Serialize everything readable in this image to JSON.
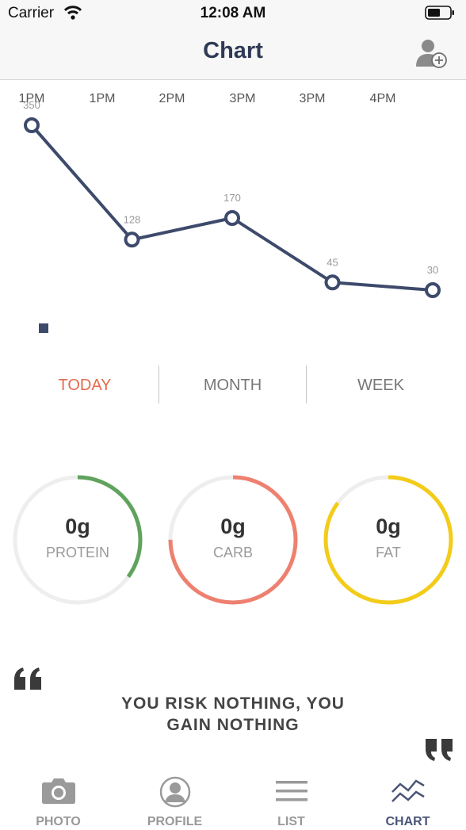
{
  "status_bar": {
    "carrier": "Carrier",
    "time": "12:08 AM"
  },
  "nav": {
    "title": "Chart",
    "add_user_icon": "add-user-icon"
  },
  "chart_data": {
    "type": "line",
    "x": [
      "1PM",
      "1PM",
      "2PM",
      "3PM",
      "3PM",
      "4PM"
    ],
    "series": [
      {
        "values": [
          350,
          128,
          170,
          45,
          30
        ],
        "color": "#3d4a6b"
      }
    ],
    "data_labels": [
      "350",
      "128",
      "170",
      "45",
      "30"
    ],
    "grid": false,
    "legend_marker_color": "#3d4a6b"
  },
  "segments": {
    "today": "TODAY",
    "month": "MONTH",
    "week": "WEEK",
    "active": "today"
  },
  "rings": [
    {
      "value": "0g",
      "label": "PROTEIN",
      "color": "#5fa35c",
      "progress": 0.35
    },
    {
      "value": "0g",
      "label": "CARB",
      "color": "#ee8070",
      "progress": 0.75
    },
    {
      "value": "0g",
      "label": "FAT",
      "color": "#f3cc1a",
      "progress": 0.85
    }
  ],
  "quote": {
    "line1": "YOU RISK NOTHING, YOU",
    "line2": "GAIN NOTHING"
  },
  "tabs": {
    "photo": "PHOTO",
    "profile": "PROFILE",
    "list": "LIST",
    "chart": "CHART",
    "active": "chart",
    "active_color": "#4a5577",
    "inactive_color": "#999999"
  }
}
